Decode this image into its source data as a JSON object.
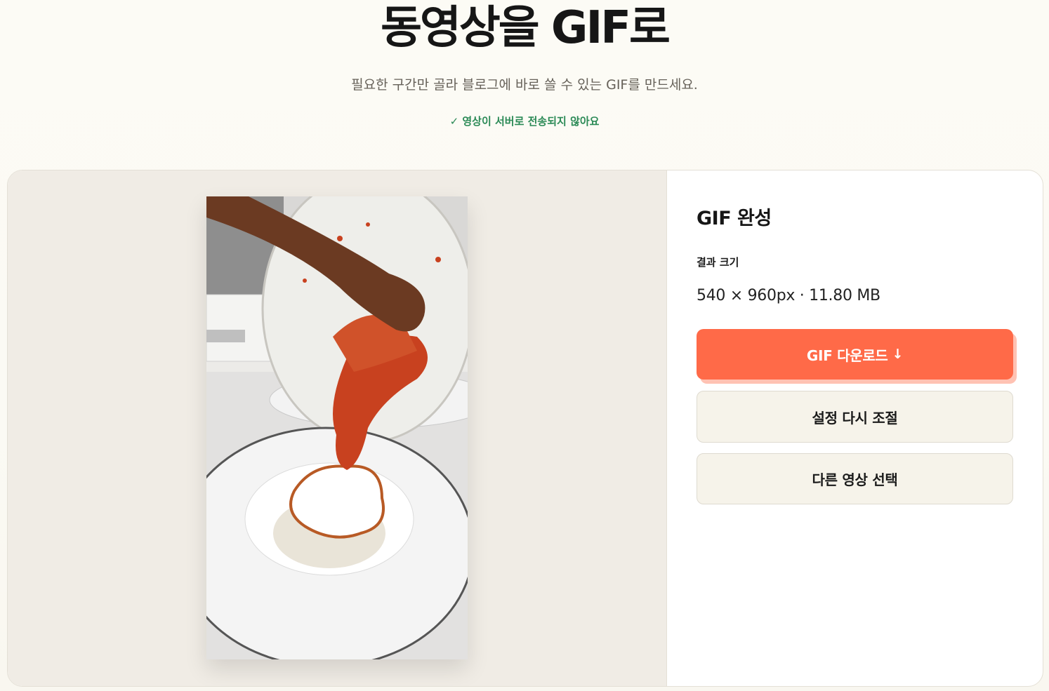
{
  "header": {
    "title": "동영상을 GIF로",
    "subtitle": "필요한 구간만 골라 블로그에 바로 쓸 수 있는 GIF를 만드세요.",
    "privacy_note": "✓ 영상이 서버로 전송되지 않아요"
  },
  "result": {
    "title": "GIF 완성",
    "size_label": "결과 크기",
    "size_value": "540 × 960px · 11.80 MB"
  },
  "actions": {
    "download_label": "GIF 다운로드",
    "download_arrow": "↓",
    "adjust_label": "설정 다시 조절",
    "other_video_label": "다른 영상 선택"
  },
  "colors": {
    "accent": "#ff6a48",
    "privacy_green": "#2b8a56",
    "secondary_button_bg": "#f6f3ea"
  }
}
